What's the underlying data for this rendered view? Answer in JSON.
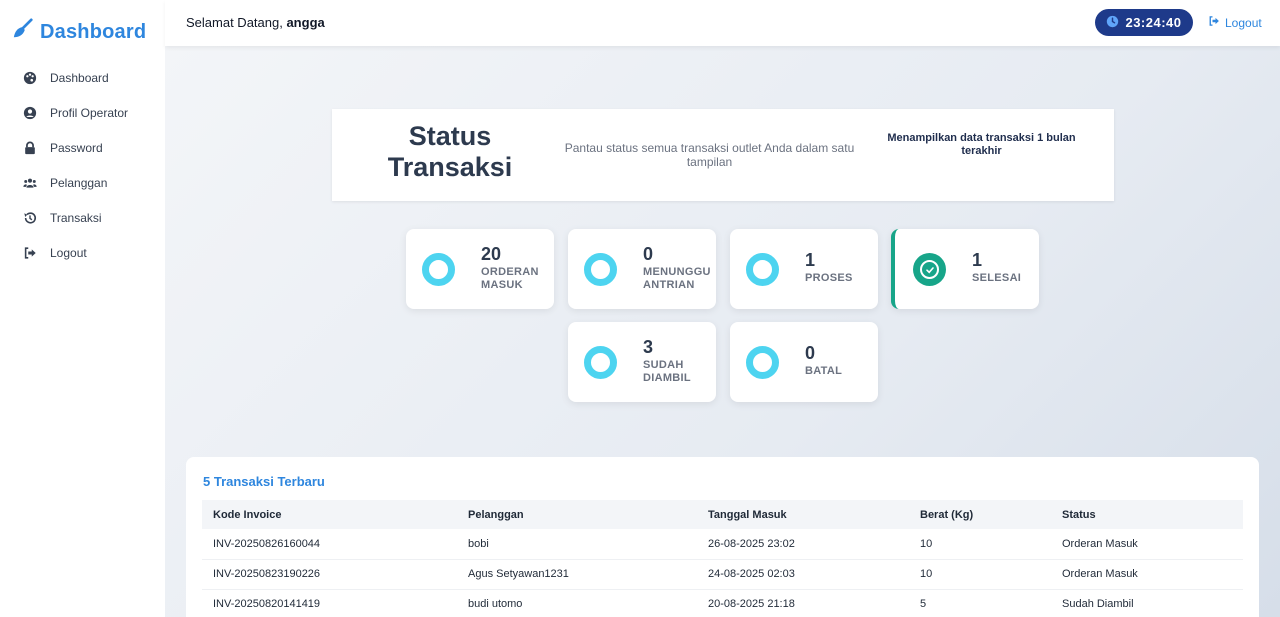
{
  "sidebar": {
    "brand": "Dashboard",
    "items": [
      {
        "label": "Dashboard",
        "icon": "palette-icon"
      },
      {
        "label": "Profil Operator",
        "icon": "user-circle-icon"
      },
      {
        "label": "Password",
        "icon": "lock-icon"
      },
      {
        "label": "Pelanggan",
        "icon": "users-icon"
      },
      {
        "label": "Transaksi",
        "icon": "history-icon"
      },
      {
        "label": "Logout",
        "icon": "sign-out-icon"
      }
    ]
  },
  "topbar": {
    "welcome_prefix": "Selamat Datang, ",
    "username": "angga",
    "clock": "23:24:40",
    "logout": "Logout"
  },
  "status_card": {
    "title": "Status Transaksi",
    "subtitle": "Pantau status semua transaksi outlet Anda dalam satu tampilan",
    "note": "Menampilkan data transaksi 1 bulan terakhir"
  },
  "stats": [
    {
      "count": "20",
      "label": "ORDERAN MASUK"
    },
    {
      "count": "0",
      "label": "MENUNGGU ANTRIAN"
    },
    {
      "count": "1",
      "label": "PROSES"
    },
    {
      "count": "1",
      "label": "SELESAI"
    },
    {
      "count": "3",
      "label": "SUDAH DIAMBIL"
    },
    {
      "count": "0",
      "label": "BATAL"
    }
  ],
  "recent": {
    "title": "5 Transaksi Terbaru",
    "columns": [
      "Kode Invoice",
      "Pelanggan",
      "Tanggal Masuk",
      "Berat (Kg)",
      "Status"
    ],
    "rows": [
      [
        "INV-20250826160044",
        "bobi",
        "26-08-2025 23:02",
        "10",
        "Orderan Masuk"
      ],
      [
        "INV-20250823190226",
        "Agus Setyawan1231",
        "24-08-2025 02:03",
        "10",
        "Orderan Masuk"
      ],
      [
        "INV-20250820141419",
        "budi utomo",
        "20-08-2025 21:18",
        "5",
        "Sudah Diambil"
      ]
    ]
  },
  "colors": {
    "accent": "#2e86de",
    "clock_bg": "#1e3a8a",
    "ring": "#4dd4f0",
    "success": "#17a589"
  }
}
